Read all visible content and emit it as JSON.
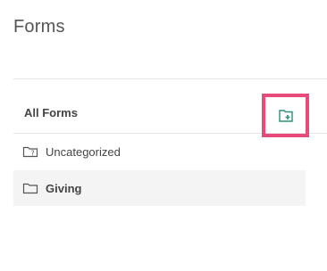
{
  "page": {
    "title": "Forms"
  },
  "panel": {
    "all_forms_label": "All Forms",
    "add_folder_icon": "folder-plus-icon",
    "highlight_color": "#e84a7a",
    "add_folder_icon_color": "#2f8f7a",
    "items": [
      {
        "label": "Uncategorized",
        "icon": "folder-question-icon",
        "selected": false
      },
      {
        "label": "Giving",
        "icon": "folder-icon",
        "selected": true
      }
    ]
  }
}
